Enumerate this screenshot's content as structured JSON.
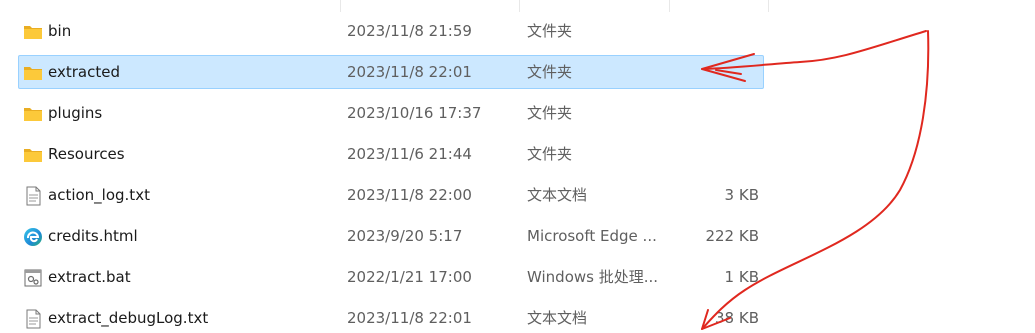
{
  "files": [
    {
      "name": "bin",
      "date": "2023/11/8 21:59",
      "type": "文件夹",
      "size": "",
      "icon": "folder-icon",
      "selected": false
    },
    {
      "name": "extracted",
      "date": "2023/11/8 22:01",
      "type": "文件夹",
      "size": "",
      "icon": "folder-icon",
      "selected": true
    },
    {
      "name": "plugins",
      "date": "2023/10/16 17:37",
      "type": "文件夹",
      "size": "",
      "icon": "folder-icon",
      "selected": false
    },
    {
      "name": "Resources",
      "date": "2023/11/6 21:44",
      "type": "文件夹",
      "size": "",
      "icon": "folder-icon",
      "selected": false
    },
    {
      "name": "action_log.txt",
      "date": "2023/11/8 22:00",
      "type": "文本文档",
      "size": "3 KB",
      "icon": "text-file-icon",
      "selected": false
    },
    {
      "name": "credits.html",
      "date": "2023/9/20 5:17",
      "type": "Microsoft Edge ...",
      "size": "222 KB",
      "icon": "edge-icon",
      "selected": false
    },
    {
      "name": "extract.bat",
      "date": "2022/1/21 17:00",
      "type": "Windows 批处理...",
      "size": "1 KB",
      "icon": "batch-file-icon",
      "selected": false
    },
    {
      "name": "extract_debugLog.txt",
      "date": "2023/11/8 22:01",
      "type": "文本文档",
      "size": "38 KB",
      "icon": "text-file-icon",
      "selected": false
    }
  ],
  "colors": {
    "selection_bg": "#cce8ff",
    "selection_border": "#99d1ff",
    "folder": "#f8c537",
    "annotation": "#e0281f"
  }
}
